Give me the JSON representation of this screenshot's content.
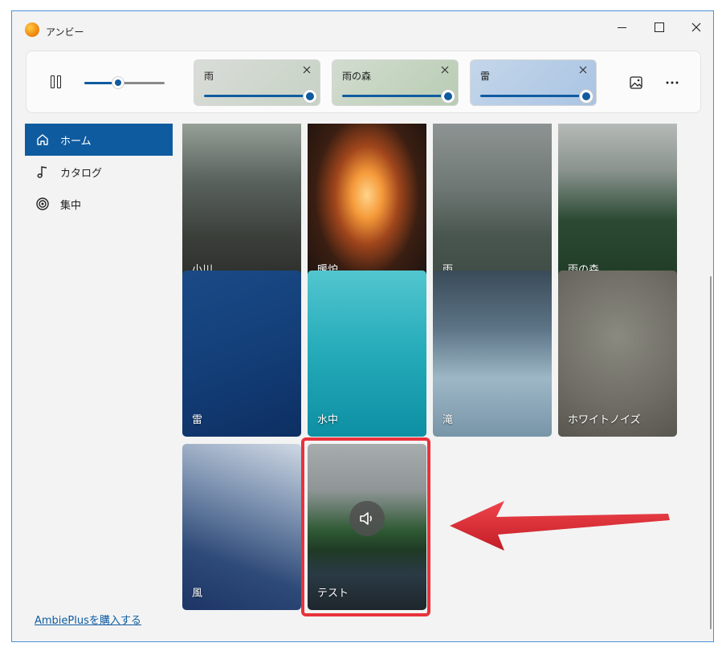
{
  "window": {
    "title": "アンビー",
    "controls": {
      "minimize": "minimize-icon",
      "maximize": "maximize-icon",
      "close": "close-icon"
    }
  },
  "player": {
    "play_state": "playing",
    "volume": 0.42,
    "active_sounds": [
      {
        "label": "雨",
        "level": 1.0,
        "colors": [
          "#d9ddd8",
          "#c7d2c5"
        ]
      },
      {
        "label": "雨の森",
        "level": 1.0,
        "colors": [
          "#d2dccf",
          "#b8ccb3"
        ]
      },
      {
        "label": "雷",
        "level": 1.0,
        "colors": [
          "#c4d6ea",
          "#a9c4e3"
        ]
      }
    ],
    "tools": [
      "image-icon",
      "more-icon"
    ]
  },
  "sidebar": {
    "items": [
      {
        "label": "ホーム",
        "icon": "home-icon",
        "active": true
      },
      {
        "label": "カタログ",
        "icon": "music-note-icon",
        "active": false
      },
      {
        "label": "集中",
        "icon": "target-icon",
        "active": false
      }
    ],
    "buy_link": "AmbiePlusを購入する"
  },
  "sounds": [
    {
      "label": "小川",
      "bg": "linear-gradient(180deg,#9aa39a 0%,#5c6460 35%,#3b3f3a 70%,#2a2c28 100%)"
    },
    {
      "label": "暖炉",
      "bg": "radial-gradient(ellipse at 50% 45%,#ffd48a 0%,#f59a3a 18%,#a1461c 38%,#3a1e12 62%,#1a120e 100%)"
    },
    {
      "label": "雨",
      "bg": "linear-gradient(180deg,#8f9594 0%,#6f7875 40%,#49554f 70%,#3e4a44 100%)"
    },
    {
      "label": "雨の森",
      "bg": "linear-gradient(180deg,#b9bdbb 0%,#8a938e 30%,#2c4a33 60%,#1f3a25 100%)"
    },
    {
      "label": "雷",
      "bg": "linear-gradient(160deg,#1a4a86 0%,#14407a 45%,#0d2f63 100%)"
    },
    {
      "label": "水中",
      "bg": "linear-gradient(180deg,#52c6cf 0%,#24aab9 50%,#0e8fa3 100%)"
    },
    {
      "label": "滝",
      "bg": "linear-gradient(180deg,#3a4b58 0%,#5c7486 35%,#9db7c6 65%,#7895a8 100%)"
    },
    {
      "label": "ホワイトノイズ",
      "bg": "radial-gradient(circle at 50% 40%,#8a8a80 0%,#6e6c64 60%,#58564f 100%)"
    },
    {
      "label": "風",
      "bg": "linear-gradient(200deg,#cfd8e4 0%,#7e93b1 35%,#2e4a78 70%,#1c3566 100%)"
    },
    {
      "label": "テスト",
      "bg": "linear-gradient(180deg,#a7acad 0%,#8f9596 28%,#2f5a34 52%,#1f3a25 64%,#2a3a44 78%,#1e262c 100%)",
      "playing": true,
      "highlighted": true
    }
  ],
  "colors": {
    "accent": "#0f5ba0",
    "highlight": "#e8323c"
  }
}
